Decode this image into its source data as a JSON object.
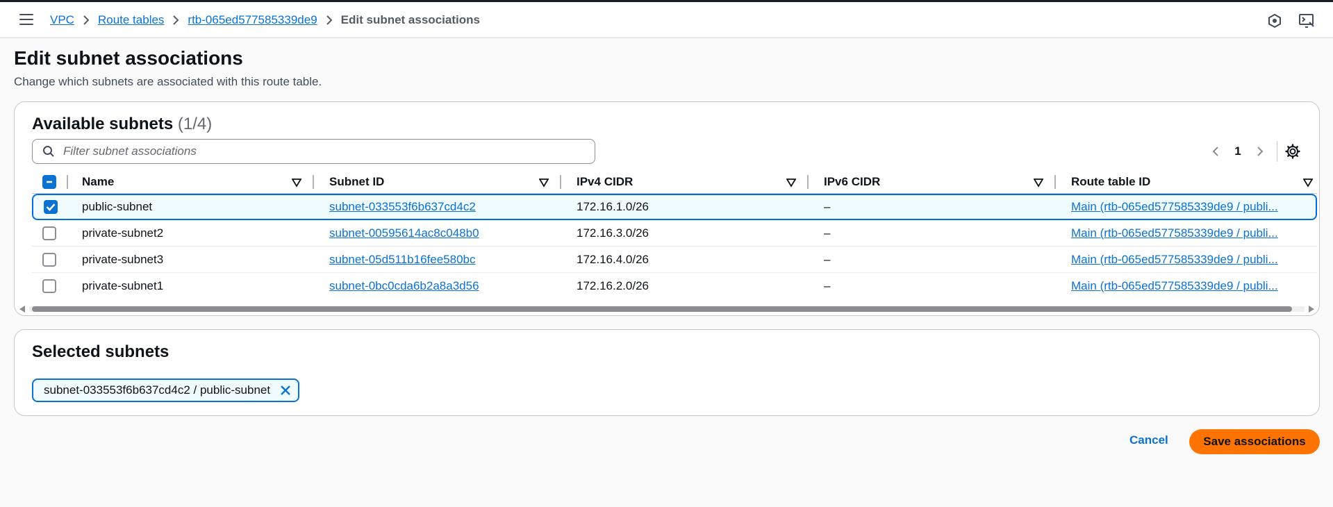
{
  "header": {
    "breadcrumbs": [
      "VPC",
      "Route tables",
      "rtb-065ed577585339de9"
    ],
    "current": "Edit subnet associations"
  },
  "page": {
    "title": "Edit subnet associations",
    "description": "Change which subnets are associated with this route table."
  },
  "available": {
    "title": "Available subnets",
    "count": "(1/4)",
    "filter_placeholder": "Filter subnet associations",
    "page_number": "1",
    "columns": [
      "Name",
      "Subnet ID",
      "IPv4 CIDR",
      "IPv6 CIDR",
      "Route table ID"
    ],
    "rows": [
      {
        "selected": true,
        "name": "public-subnet",
        "subnet_id": "subnet-033553f6b637cd4c2",
        "ipv4": "172.16.1.0/26",
        "ipv6": "–",
        "route_table": "Main (rtb-065ed577585339de9 / publi..."
      },
      {
        "selected": false,
        "name": "private-subnet2",
        "subnet_id": "subnet-00595614ac8c048b0",
        "ipv4": "172.16.3.0/26",
        "ipv6": "–",
        "route_table": "Main (rtb-065ed577585339de9 / publi..."
      },
      {
        "selected": false,
        "name": "private-subnet3",
        "subnet_id": "subnet-05d511b16fee580bc",
        "ipv4": "172.16.4.0/26",
        "ipv6": "–",
        "route_table": "Main (rtb-065ed577585339de9 / publi..."
      },
      {
        "selected": false,
        "name": "private-subnet1",
        "subnet_id": "subnet-0bc0cda6b2a8a3d56",
        "ipv4": "172.16.2.0/26",
        "ipv6": "–",
        "route_table": "Main (rtb-065ed577585339de9 / publi..."
      }
    ]
  },
  "selected": {
    "title": "Selected subnets",
    "tokens": [
      "subnet-033553f6b637cd4c2 / public-subnet"
    ]
  },
  "actions": {
    "cancel": "Cancel",
    "save": "Save associations"
  },
  "colors": {
    "link": "#0972d3",
    "primary_button": "#ff7300",
    "selected_row_bg": "#f0fbff"
  },
  "icons": [
    "menu-icon",
    "chevron-right-icon",
    "notifications-icon",
    "cloudshell-icon",
    "search-icon",
    "chevron-left-icon",
    "settings-gear-icon",
    "sort-icon",
    "check-icon",
    "close-icon"
  ]
}
